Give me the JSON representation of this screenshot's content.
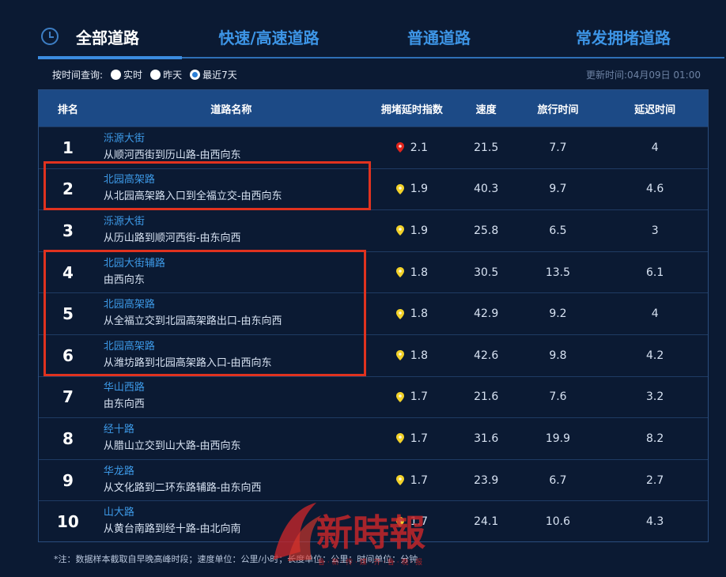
{
  "tabs": [
    {
      "label": "全部道路",
      "active": true
    },
    {
      "label": "快速/高速道路",
      "active": false
    },
    {
      "label": "普通道路",
      "active": false
    },
    {
      "label": "常发拥堵道路",
      "active": false
    }
  ],
  "filter": {
    "label": "按时间查询:",
    "options": [
      "实时",
      "昨天",
      "最近7天"
    ],
    "selected": "最近7天",
    "updated": "更新时间:04月09日 01:00"
  },
  "table": {
    "headers": [
      "排名",
      "道路名称",
      "拥堵延时指数",
      "速度",
      "旅行时间",
      "延迟时间"
    ],
    "rows": [
      {
        "rank": "1",
        "road": "泺源大街",
        "direction": "从顺河西街到历山路-由西向东",
        "index": "2.1",
        "speed": "21.5",
        "travel": "7.7",
        "delay": "4",
        "pin_color": "#e2251c"
      },
      {
        "rank": "2",
        "road": "北园高架路",
        "direction": "从北园高架路入口到全福立交-由西向东",
        "index": "1.9",
        "speed": "40.3",
        "travel": "9.7",
        "delay": "4.6",
        "pin_color": "#f3d229"
      },
      {
        "rank": "3",
        "road": "泺源大街",
        "direction": "从历山路到顺河西街-由东向西",
        "index": "1.9",
        "speed": "25.8",
        "travel": "6.5",
        "delay": "3",
        "pin_color": "#f3d229"
      },
      {
        "rank": "4",
        "road": "北园大街辅路",
        "direction": "由西向东",
        "index": "1.8",
        "speed": "30.5",
        "travel": "13.5",
        "delay": "6.1",
        "pin_color": "#f3d229"
      },
      {
        "rank": "5",
        "road": "北园高架路",
        "direction": "从全福立交到北园高架路出口-由东向西",
        "index": "1.8",
        "speed": "42.9",
        "travel": "9.2",
        "delay": "4",
        "pin_color": "#f3d229"
      },
      {
        "rank": "6",
        "road": "北园高架路",
        "direction": "从潍坊路到北园高架路入口-由西向东",
        "index": "1.8",
        "speed": "42.6",
        "travel": "9.8",
        "delay": "4.2",
        "pin_color": "#f3d229"
      },
      {
        "rank": "7",
        "road": "华山西路",
        "direction": "由东向西",
        "index": "1.7",
        "speed": "21.6",
        "travel": "7.6",
        "delay": "3.2",
        "pin_color": "#f3d229"
      },
      {
        "rank": "8",
        "road": "经十路",
        "direction": "从腊山立交到山大路-由西向东",
        "index": "1.7",
        "speed": "31.6",
        "travel": "19.9",
        "delay": "8.2",
        "pin_color": "#f3d229"
      },
      {
        "rank": "9",
        "road": "华龙路",
        "direction": "从文化路到二环东路辅路-由东向西",
        "index": "1.7",
        "speed": "23.9",
        "travel": "6.7",
        "delay": "2.7",
        "pin_color": "#f3d229"
      },
      {
        "rank": "10",
        "road": "山大路",
        "direction": "从黄台南路到经十路-由北向南",
        "index": "1.7",
        "speed": "24.1",
        "travel": "10.6",
        "delay": "4.3",
        "pin_color": "#f3d229"
      }
    ]
  },
  "note": "*注：数据样本截取自早晚高峰时段；速度单位：公里/小时；长度单位：公里；时间单位：分钟",
  "watermark": {
    "text": "新時報",
    "subtext": "鲁 · 新 · 传 · 媒 · 齐 · 鲁 · 晚 · 报"
  },
  "colors": {
    "accent": "#3d95e6",
    "header": "#1c4a86",
    "highlight": "#e0321f",
    "background": "#0b1a33"
  }
}
